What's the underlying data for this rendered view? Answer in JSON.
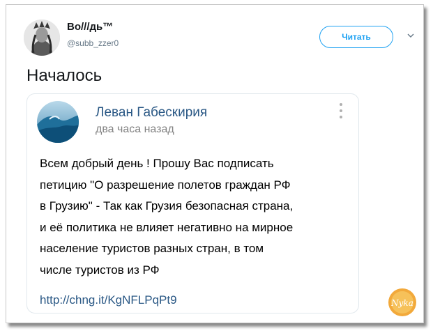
{
  "tweet": {
    "display_name": "Во///дь™",
    "handle": "@subb_zzer0",
    "follow_label": "Читать",
    "text": "Началось"
  },
  "embedded_post": {
    "author": "Леван Габескирия",
    "time": "два часа назад",
    "lines": [
      "Всем добрый день ! Прошу Вас подписать",
      "петицию \"О разрешение полетов граждан РФ",
      "в Грузию\" - Так как Грузия безопасная страна,",
      "и её политика не влияет негативно на мирное",
      "население туристов разных стран, в том",
      "числе туристов из РФ"
    ],
    "link": "http://chng.it/KgNFLPqPt9"
  },
  "watermark": {
    "text": "Nyka"
  },
  "colors": {
    "accent": "#1da1f2",
    "vk_link": "#2a5885",
    "badge": "#f2a93b"
  }
}
